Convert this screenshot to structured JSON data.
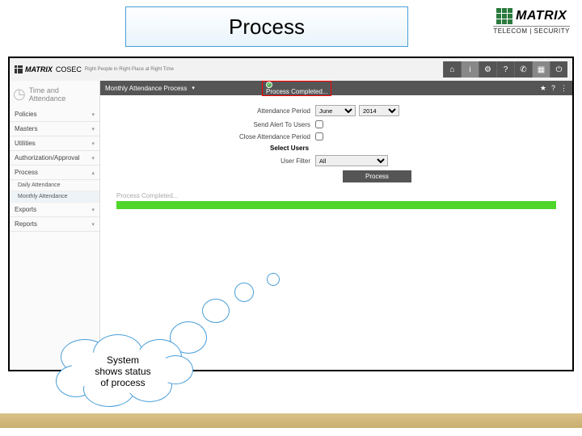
{
  "title": "Process",
  "brand": {
    "name": "MATRIX",
    "sub": "TELECOM | SECURITY"
  },
  "app": {
    "brand": "MATRIX",
    "product": "COSEC",
    "tagline": "Right People in Right Place at Right Time",
    "top_icons": [
      "home",
      "info",
      "gear",
      "question",
      "phone",
      "grid",
      "power"
    ]
  },
  "sidebar": {
    "module_title": "Time and\nAttendance",
    "items": [
      "Policies",
      "Masters",
      "Utilities",
      "Authorization/Approval",
      "Process"
    ],
    "subs": [
      "Daily Attendance",
      "Monthly Attendance"
    ],
    "tail": [
      "Exports",
      "Reports"
    ]
  },
  "mainbar": {
    "title": "Monthly Attendance Process",
    "status": "Process Completed..."
  },
  "form": {
    "period_label": "Attendance Period",
    "month": "June",
    "year": "2014",
    "alert_label": "Send Alert To Users",
    "close_label": "Close Attendance Period",
    "select_users": "Select Users",
    "filter_label": "User Filter",
    "filter_value": "All",
    "button": "Process",
    "pc_label": "Process Completed..."
  },
  "callout": "System\nshows status\nof process"
}
